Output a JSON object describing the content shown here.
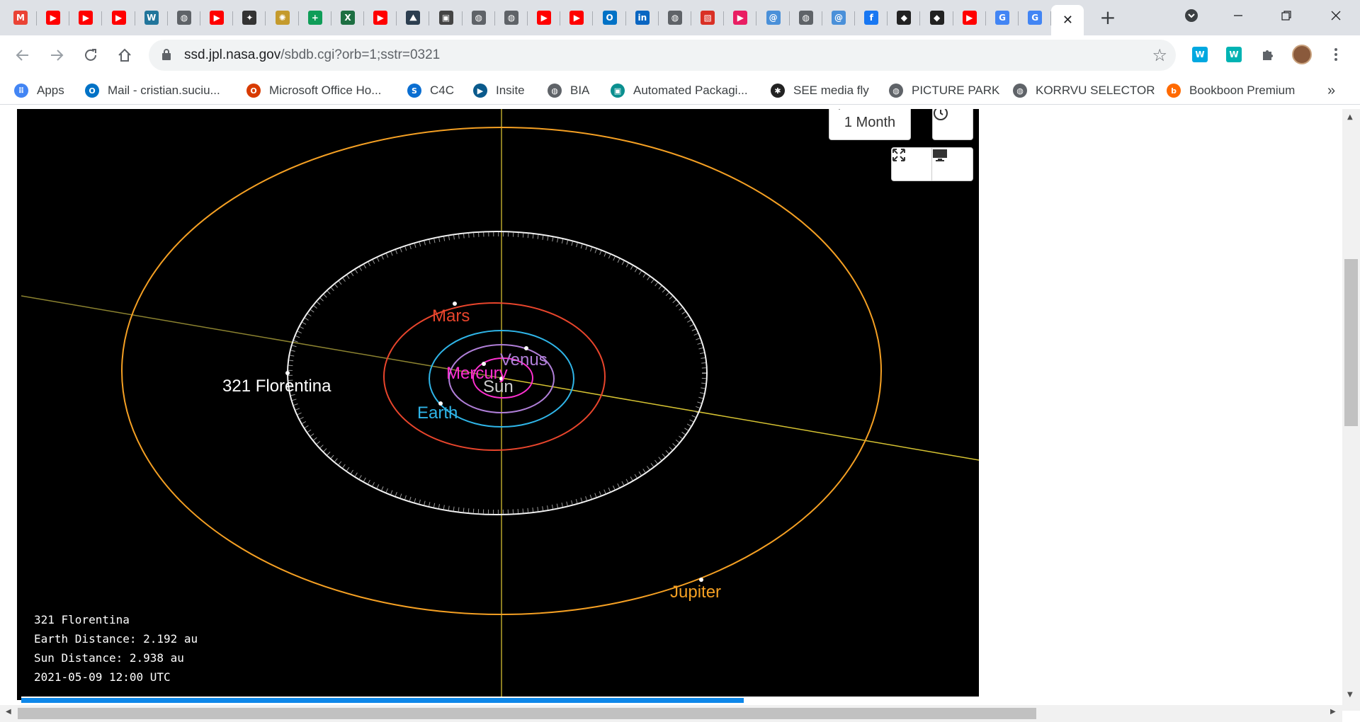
{
  "browser": {
    "url_host": "ssd.jpl.nasa.gov",
    "url_path": "/sbdb.cgi?orb=1;sstr=0321",
    "tabs": [
      {
        "icon": "gmail-icon",
        "color": "#ea4335",
        "glyph": "M"
      },
      {
        "icon": "youtube-icon",
        "color": "#ff0000",
        "glyph": "▶"
      },
      {
        "icon": "youtube-icon",
        "color": "#ff0000",
        "glyph": "▶"
      },
      {
        "icon": "youtube-icon",
        "color": "#ff0000",
        "glyph": "▶"
      },
      {
        "icon": "wordpress-icon",
        "color": "#21759b",
        "glyph": "W"
      },
      {
        "icon": "globe-icon",
        "color": "#5f6368",
        "glyph": "◍"
      },
      {
        "icon": "youtube-icon",
        "color": "#ff0000",
        "glyph": "▶"
      },
      {
        "icon": "image-icon",
        "color": "#333333",
        "glyph": "✦"
      },
      {
        "icon": "image-icon",
        "color": "#c49a2c",
        "glyph": "✺"
      },
      {
        "icon": "sheets-icon",
        "color": "#0f9d58",
        "glyph": "+"
      },
      {
        "icon": "excel-icon",
        "color": "#1d6f42",
        "glyph": "X"
      },
      {
        "icon": "youtube-icon",
        "color": "#ff0000",
        "glyph": "▶"
      },
      {
        "icon": "image-icon",
        "color": "#2c3e50",
        "glyph": "⛰"
      },
      {
        "icon": "image-icon",
        "color": "#444444",
        "glyph": "▣"
      },
      {
        "icon": "globe-icon",
        "color": "#5f6368",
        "glyph": "◍"
      },
      {
        "icon": "globe-icon",
        "color": "#5f6368",
        "glyph": "◍"
      },
      {
        "icon": "youtube-icon",
        "color": "#ff0000",
        "glyph": "▶"
      },
      {
        "icon": "youtube-icon",
        "color": "#ff0000",
        "glyph": "▶"
      },
      {
        "icon": "outlook-icon",
        "color": "#0072c6",
        "glyph": "O"
      },
      {
        "icon": "linkedin-icon",
        "color": "#0a66c2",
        "glyph": "in"
      },
      {
        "icon": "globe-icon",
        "color": "#5f6368",
        "glyph": "◍"
      },
      {
        "icon": "pattern-icon",
        "color": "#d93025",
        "glyph": "▧"
      },
      {
        "icon": "play-icon",
        "color": "#e91e63",
        "glyph": "▶"
      },
      {
        "icon": "swirl-icon",
        "color": "#4a90d9",
        "glyph": "@"
      },
      {
        "icon": "globe-icon",
        "color": "#5f6368",
        "glyph": "◍"
      },
      {
        "icon": "swirl-icon",
        "color": "#4a90d9",
        "glyph": "@"
      },
      {
        "icon": "facebook-icon",
        "color": "#1877f2",
        "glyph": "f"
      },
      {
        "icon": "bird-icon",
        "color": "#222222",
        "glyph": "◆"
      },
      {
        "icon": "bird-icon",
        "color": "#222222",
        "glyph": "◆"
      },
      {
        "icon": "youtube-icon",
        "color": "#ff0000",
        "glyph": "▶"
      },
      {
        "icon": "google-icon",
        "color": "#4285f4",
        "glyph": "G"
      },
      {
        "icon": "google-icon",
        "color": "#4285f4",
        "glyph": "G"
      }
    ],
    "active_tab_close": "✕",
    "new_tab": "+",
    "bookmarks": [
      {
        "label": "Apps",
        "icon": "apps-grid-icon",
        "color": "#4285f4",
        "glyph": "⠿"
      },
      {
        "label": "Mail - cristian.suciu...",
        "icon": "outlook-icon",
        "color": "#0072c6",
        "glyph": "O"
      },
      {
        "label": "Microsoft Office Ho...",
        "icon": "office-icon",
        "color": "#d83b01",
        "glyph": "O"
      },
      {
        "label": "C4C",
        "icon": "sap-icon",
        "color": "#0a6ed1",
        "glyph": "S"
      },
      {
        "label": "Insite",
        "icon": "insite-icon",
        "color": "#0a5a8c",
        "glyph": "▶"
      },
      {
        "label": "BIA",
        "icon": "globe-icon",
        "color": "#5f6368",
        "glyph": "◍"
      },
      {
        "label": "Automated Packagi...",
        "icon": "package-icon",
        "color": "#0a8f8f",
        "glyph": "▣"
      },
      {
        "label": "SEE media fly",
        "icon": "media-fly-icon",
        "color": "#222222",
        "glyph": "✱"
      },
      {
        "label": "PICTURE PARK",
        "icon": "globe-icon",
        "color": "#5f6368",
        "glyph": "◍"
      },
      {
        "label": "KORRVU SELECTOR",
        "icon": "globe-icon",
        "color": "#5f6368",
        "glyph": "◍"
      },
      {
        "label": "Bookboon Premium",
        "icon": "bookboon-icon",
        "color": "#ff6a00",
        "glyph": "b"
      }
    ],
    "bookmarks_overflow": "»"
  },
  "viewer": {
    "time_step": "1 Month",
    "info": {
      "object": "321 Florentina",
      "earth_distance": "Earth Distance: 2.192 au",
      "sun_distance": "Sun Distance: 2.938 au",
      "datetime": "2021-05-09 12:00 UTC"
    },
    "labels": {
      "asteroid": "321 Florentina",
      "mars": "Mars",
      "venus": "Venus",
      "mercury": "Mercury",
      "sun": "Sun",
      "earth": "Earth",
      "jupiter": "Jupiter"
    },
    "colors": {
      "asteroid": "#ffffff",
      "mars": "#e8452c",
      "venus": "#b07fd8",
      "mercury": "#ff30d0",
      "sun": "#cccccc",
      "earth": "#2fb5e8",
      "jupiter": "#f5a023",
      "ecliptic_axis": "#d6c332",
      "progress": "#0d87e9"
    }
  }
}
